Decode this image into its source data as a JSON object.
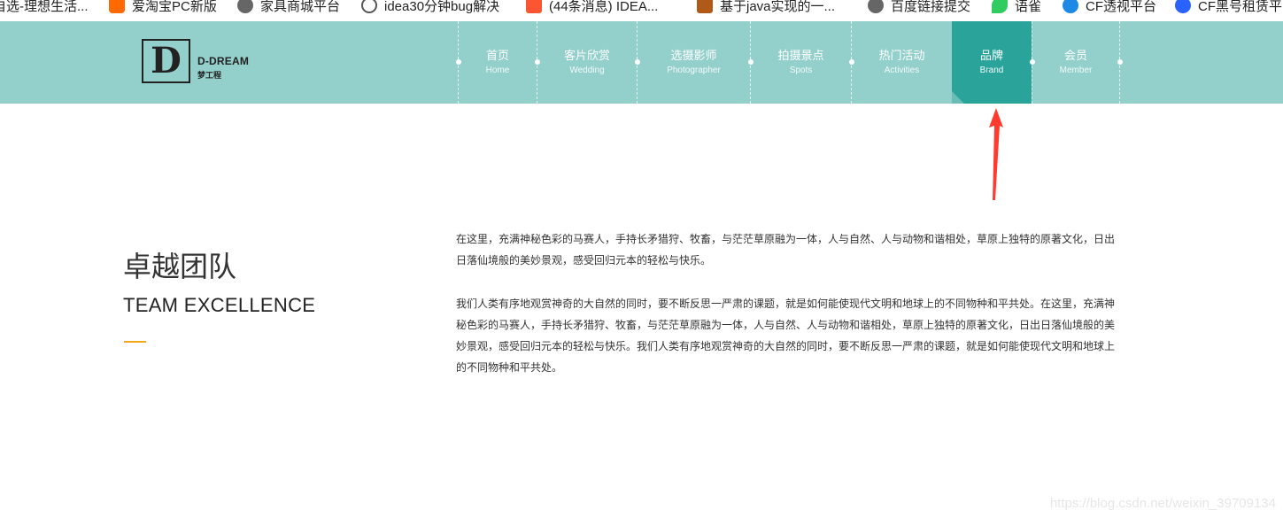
{
  "bookmarks": [
    {
      "label": "自选-理想生活...",
      "icon": "none",
      "color": "#ffffff"
    },
    {
      "label": "爱淘宝PC新版",
      "icon": "taobao-icon",
      "color": "#ff6a00"
    },
    {
      "label": "家具商城平台",
      "icon": "globe-icon",
      "color": "#555555"
    },
    {
      "label": "idea30分钟bug解决",
      "icon": "search-icon",
      "color": "#555555"
    },
    {
      "label": "(44条消息) IDEA...",
      "icon": "csdn-icon",
      "color": "#fc5531"
    },
    {
      "label": "基于java实现的一...",
      "icon": "b-icon",
      "color": "#b05a1a"
    },
    {
      "label": "百度链接提交",
      "icon": "globe-icon",
      "color": "#555555"
    },
    {
      "label": "语雀",
      "icon": "yuque-icon",
      "color": "#31cc5f"
    },
    {
      "label": "CF透视平台",
      "icon": "cf-icon",
      "color": "#1e88e5"
    },
    {
      "label": "CF黑号租赁平",
      "icon": "cf-icon",
      "color": "#2962ff"
    }
  ],
  "logo": {
    "en": "D-DREAM",
    "cn": "梦工程",
    "mark": "D"
  },
  "nav": [
    {
      "cn": "首页",
      "en": "Home"
    },
    {
      "cn": "客片欣赏",
      "en": "Wedding"
    },
    {
      "cn": "选摄影师",
      "en": "Photographer"
    },
    {
      "cn": "拍摄景点",
      "en": "Spots"
    },
    {
      "cn": "热门活动",
      "en": "Activities"
    },
    {
      "cn": "品牌",
      "en": "Brand",
      "active": true
    },
    {
      "cn": "会员",
      "en": "Member"
    }
  ],
  "section": {
    "title_cn": "卓越团队",
    "title_en": "TEAM EXCELLENCE",
    "para1": "在这里，充满神秘色彩的马赛人，手持长矛猎狩、牧畜，与茫茫草原融为一体，人与自然、人与动物和谐相处，草原上独特的原著文化，日出日落仙境般的美妙景观，感受回归元本的轻松与快乐。",
    "para2": "我们人类有序地观赏神奇的大自然的同时，要不断反思一严肃的课题，就是如何能使现代文明和地球上的不同物种和平共处。在这里，充满神秘色彩的马赛人，手持长矛猎狩、牧畜，与茫茫草原融为一体，人与自然、人与动物和谐相处，草原上独特的原著文化，日出日落仙境般的美妙景观，感受回归元本的轻松与快乐。我们人类有序地观赏神奇的大自然的同时，要不断反思一严肃的课题，就是如何能使现代文明和地球上的不同物种和平共处。"
  },
  "watermark": "https://blog.csdn.net/weixin_39709134",
  "colors": {
    "nav_bg": "#93cfcb",
    "nav_active": "#2aa49a",
    "accent_line": "#f2a81d",
    "arrow": "#ff3b30"
  }
}
